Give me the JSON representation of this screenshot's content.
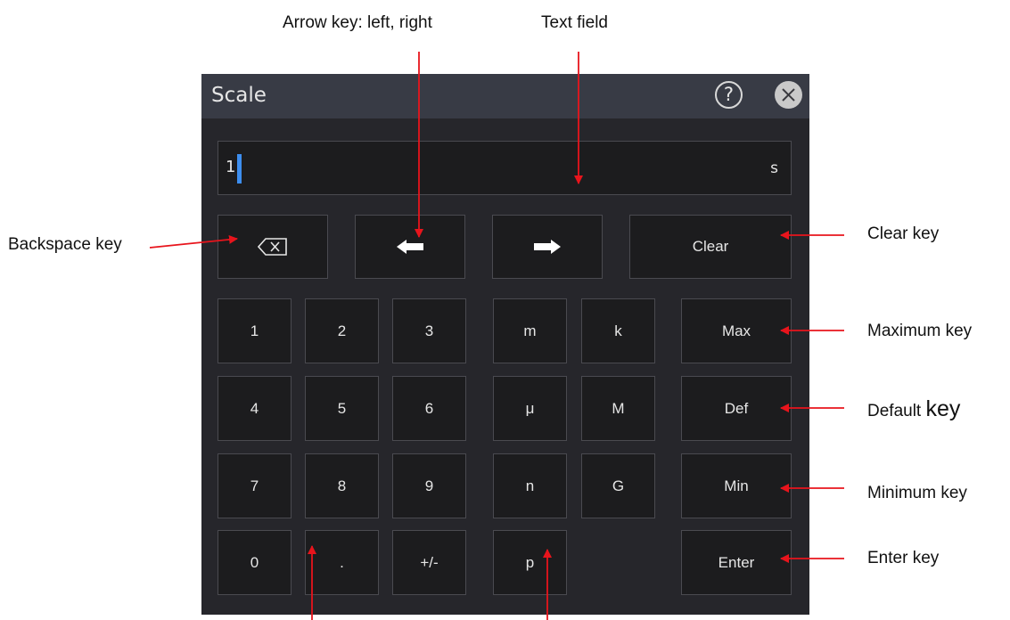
{
  "dialog": {
    "title": "Scale",
    "help_icon": "question-circle-icon",
    "close_icon": "close-circle-icon"
  },
  "text_field": {
    "value": "1",
    "unit": "s"
  },
  "controls": {
    "backspace_icon": "backspace-icon",
    "left_icon": "arrow-left-icon",
    "right_icon": "arrow-right-icon",
    "clear": "Clear"
  },
  "digits": [
    "1",
    "2",
    "3",
    "4",
    "5",
    "6",
    "7",
    "8",
    "9",
    "0",
    ".",
    "+/-"
  ],
  "units": [
    "m",
    "k",
    "μ",
    "M",
    "n",
    "G",
    "p"
  ],
  "functions": {
    "max": "Max",
    "def": "Def",
    "min": "Min",
    "enter": "Enter"
  },
  "annotations": {
    "arrow_key": "Arrow key: left, right",
    "text_field": "Text field",
    "backspace_key": "Backspace key",
    "clear_key": "Clear key",
    "maximum_key": "Maximum key",
    "default_key_a": "Default ",
    "default_key_b": "key",
    "minimum_key": "Minimum key",
    "enter_key": "Enter key"
  },
  "colors": {
    "annotation_arrow": "#e8141c",
    "caret": "#3d8eef"
  }
}
